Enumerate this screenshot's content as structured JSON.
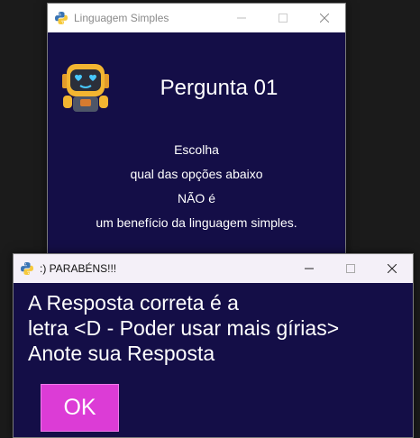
{
  "main_window": {
    "title": "Linguagem Simples",
    "question_title": "Pergunta 01",
    "question_lines": [
      "Escolha",
      "qual das opções abaixo",
      "NÃO é",
      "um benefício da linguagem simples."
    ],
    "icons": {
      "app": "python-icon",
      "mascot": "robot-emoji-icon"
    }
  },
  "dialog": {
    "title": ":) PARABÉNS!!!",
    "message_lines": [
      "A Resposta correta é a",
      "letra <D - Poder usar mais gírias>",
      "Anote sua Resposta"
    ],
    "ok_label": "OK"
  },
  "colors": {
    "window_background": "#140e47",
    "ok_button": "#dc3cd6",
    "text": "#ffffff"
  }
}
